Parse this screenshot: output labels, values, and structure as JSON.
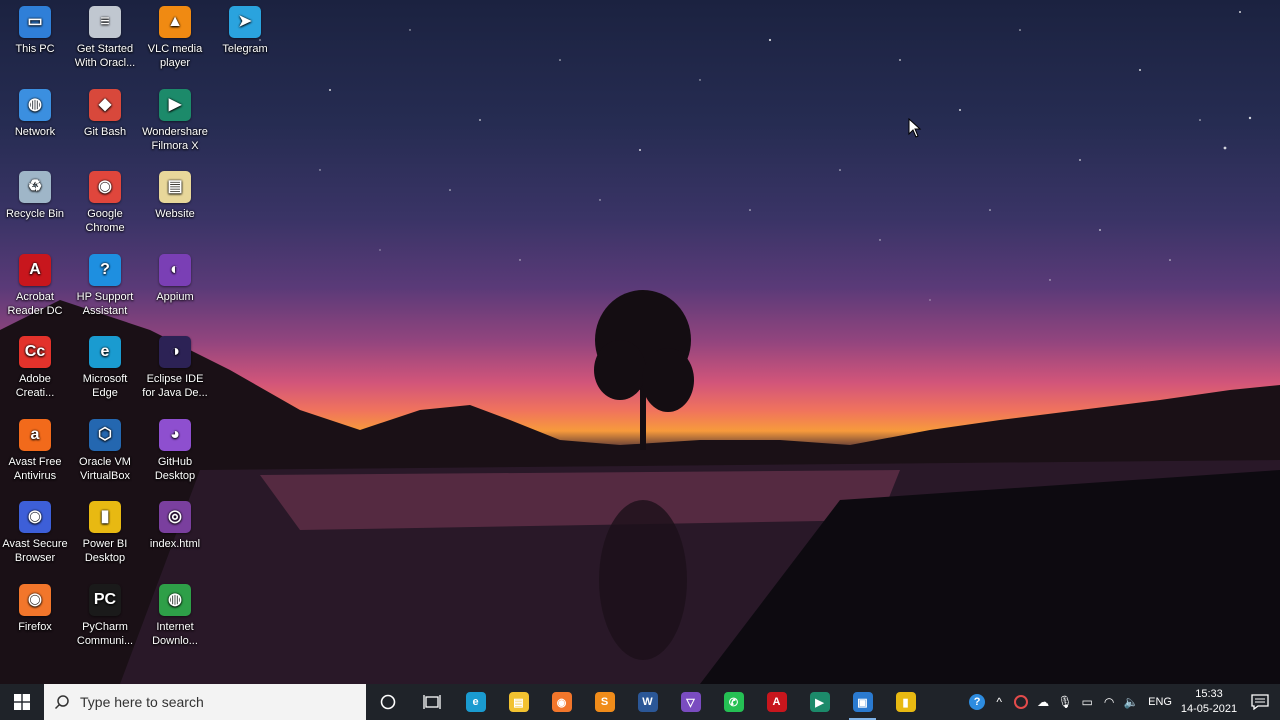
{
  "desktop": {
    "icons": [
      {
        "label": "This PC",
        "icon": "this-pc-icon",
        "color": "#2f7fd8",
        "glyph": "▭"
      },
      {
        "label": "Get Started With Oracl...",
        "icon": "oracle-database-icon",
        "color": "#c0c7d0",
        "glyph": "≡"
      },
      {
        "label": "VLC media player",
        "icon": "vlc-icon",
        "color": "#f08a12",
        "glyph": "▲"
      },
      {
        "label": "Telegram",
        "icon": "telegram-icon",
        "color": "#2aa3de",
        "glyph": "➤"
      },
      {
        "label": "Network",
        "icon": "network-icon",
        "color": "#3b8fe0",
        "glyph": "◍"
      },
      {
        "label": "Git Bash",
        "icon": "git-bash-icon",
        "color": "#d8483b",
        "glyph": "◆"
      },
      {
        "label": "Wondershare Filmora X",
        "icon": "filmora-icon",
        "color": "#1c8a6a",
        "glyph": "▶"
      },
      {
        "label": "Recycle Bin",
        "icon": "recycle-bin-icon",
        "color": "#9fb6c8",
        "glyph": "♻"
      },
      {
        "label": "Google Chrome",
        "icon": "chrome-icon",
        "color": "#e0463c",
        "glyph": "◉"
      },
      {
        "label": "Website",
        "icon": "website-folder-icon",
        "color": "#e8d79a",
        "glyph": "▤"
      },
      {
        "label": "Acrobat Reader DC",
        "icon": "acrobat-icon",
        "color": "#c8161d",
        "glyph": "A"
      },
      {
        "label": "HP Support Assistant",
        "icon": "hp-support-icon",
        "color": "#1e8fe0",
        "glyph": "?"
      },
      {
        "label": "Appium",
        "icon": "appium-icon",
        "color": "#7a3fb5",
        "glyph": "◐"
      },
      {
        "label": "Adobe Creati...",
        "icon": "adobe-creative-cloud-icon",
        "color": "#e3322b",
        "glyph": "Cc"
      },
      {
        "label": "Microsoft Edge",
        "icon": "edge-icon",
        "color": "#1a9bd0",
        "glyph": "e"
      },
      {
        "label": "Eclipse IDE for Java De...",
        "icon": "eclipse-icon",
        "color": "#2c2255",
        "glyph": "◑"
      },
      {
        "label": "Avast Free Antivirus",
        "icon": "avast-icon",
        "color": "#f26a1b",
        "glyph": "a"
      },
      {
        "label": "Oracle VM VirtualBox",
        "icon": "virtualbox-icon",
        "color": "#2467b0",
        "glyph": "⬡"
      },
      {
        "label": "GitHub Desktop",
        "icon": "github-desktop-icon",
        "color": "#8e4fcf",
        "glyph": "◕"
      },
      {
        "label": "Avast Secure Browser",
        "icon": "avast-secure-browser-icon",
        "color": "#3d5fd8",
        "glyph": "◉"
      },
      {
        "label": "Power BI Desktop",
        "icon": "power-bi-icon",
        "color": "#e8b912",
        "glyph": "▮"
      },
      {
        "label": "index.html",
        "icon": "html-file-icon",
        "color": "#7a3f9e",
        "glyph": "◎"
      },
      {
        "label": "Firefox",
        "icon": "firefox-icon",
        "color": "#f2762b",
        "glyph": "◉"
      },
      {
        "label": "PyCharm Communi...",
        "icon": "pycharm-icon",
        "color": "#1a1a1a",
        "glyph": "PC"
      },
      {
        "label": "Internet Downlo...",
        "icon": "internet-download-manager-icon",
        "color": "#2e9f48",
        "glyph": "◍"
      }
    ]
  },
  "taskbar": {
    "search_placeholder": "Type here to search",
    "pinned": [
      {
        "name": "edge",
        "color": "#1a9bd0",
        "glyph": "e",
        "active": false
      },
      {
        "name": "file-explorer",
        "color": "#f2c230",
        "glyph": "▤",
        "active": false
      },
      {
        "name": "firefox",
        "color": "#f2762b",
        "glyph": "◉",
        "active": false
      },
      {
        "name": "sublime-text",
        "color": "#f08c1a",
        "glyph": "S",
        "active": false
      },
      {
        "name": "word",
        "color": "#2b5797",
        "glyph": "W",
        "active": false
      },
      {
        "name": "visual-studio",
        "color": "#7a4cc0",
        "glyph": "▽",
        "active": false
      },
      {
        "name": "whatsapp",
        "color": "#25c054",
        "glyph": "✆",
        "active": false
      },
      {
        "name": "acrobat",
        "color": "#c8161d",
        "glyph": "A",
        "active": false
      },
      {
        "name": "filmora",
        "color": "#1c8a6a",
        "glyph": "▶",
        "active": false
      },
      {
        "name": "photos",
        "color": "#2a7ad0",
        "glyph": "▣",
        "active": true
      },
      {
        "name": "power-bi",
        "color": "#e8b912",
        "glyph": "▮",
        "active": false
      }
    ],
    "tray": {
      "lang": "ENG",
      "time": "15:33",
      "date": "14-05-2021"
    }
  }
}
